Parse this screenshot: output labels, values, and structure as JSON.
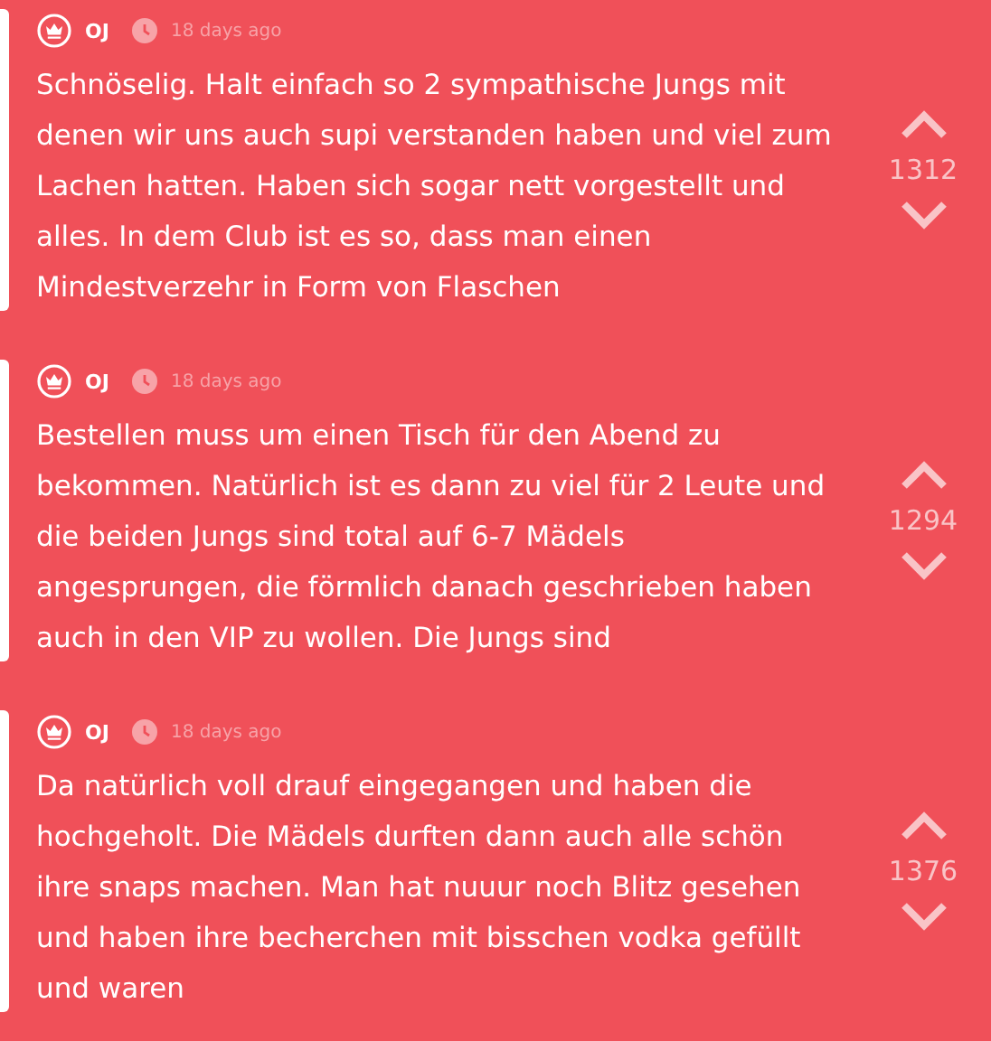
{
  "posts": [
    {
      "author": "OJ",
      "time": "18 days ago",
      "text": "Schnöselig. Halt einfach so 2 sympathische Jungs mit denen wir uns auch supi verstanden haben und viel zum Lachen hatten. Haben sich sogar nett vorgestellt und alles. In dem Club ist es so, dass man einen Mindestverzehr in Form von Flaschen",
      "votes": "1312"
    },
    {
      "author": "OJ",
      "time": "18 days ago",
      "text": "Bestellen muss um einen Tisch für den Abend zu bekommen. Natürlich ist es dann zu viel für 2 Leute und die beiden Jungs sind total auf 6-7 Mädels angesprungen, die förmlich danach geschrieben haben auch in den VIP zu wollen. Die Jungs sind",
      "votes": "1294"
    },
    {
      "author": "OJ",
      "time": "18 days ago",
      "text": "Da natürlich voll drauf eingegangen und haben die hochgeholt. Die Mädels durften dann auch alle schön ihre snaps machen. Man hat nuuur noch Blitz gesehen und haben ihre becherchen mit bisschen vodka gefüllt und waren",
      "votes": "1376"
    }
  ]
}
